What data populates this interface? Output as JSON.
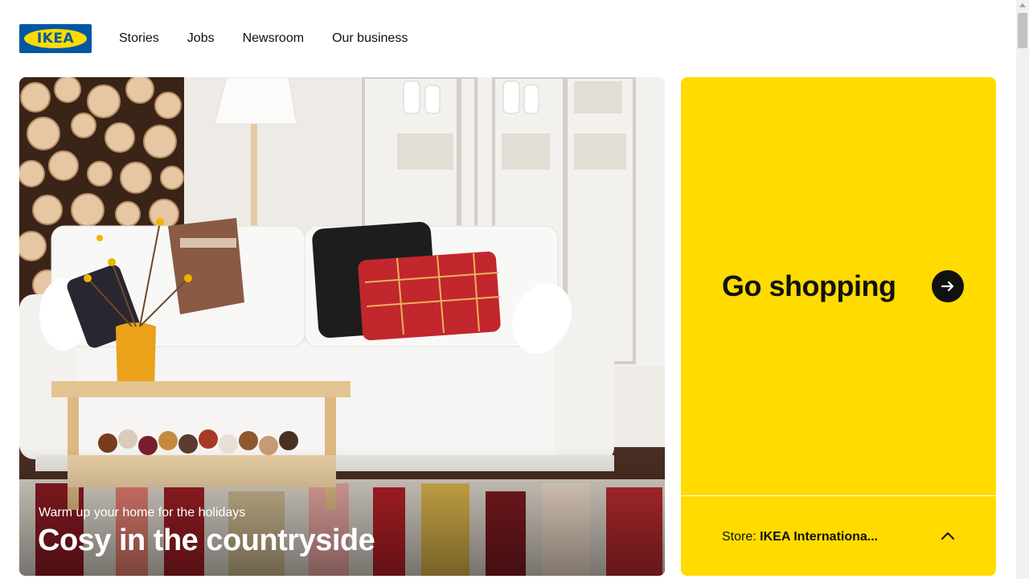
{
  "brand": {
    "logo_text": "IKEA",
    "blue": "#0058a3",
    "yellow": "#ffdb00"
  },
  "nav": {
    "items": [
      "Stories",
      "Jobs",
      "Newsroom",
      "Our business"
    ]
  },
  "hero": {
    "subtitle": "Warm up your home for the holidays",
    "title": "Cosy in the countryside"
  },
  "promo": {
    "title": "Go shopping",
    "arrow_icon": "arrow-right-icon",
    "store_label": "Store:",
    "store_name": "IKEA Internationa...",
    "chevron_icon": "chevron-up-icon"
  }
}
